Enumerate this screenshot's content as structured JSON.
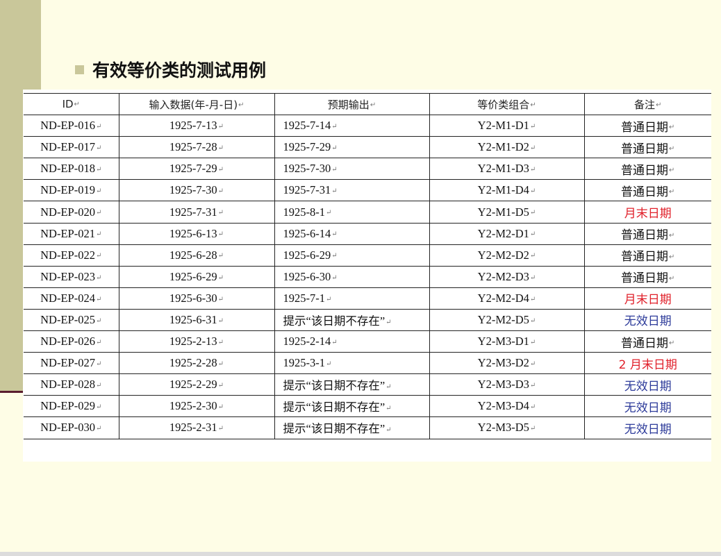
{
  "slide": {
    "heading": "有效等价类的测试用例",
    "colors": {
      "background": "#fefde6",
      "side_bar": "#c9c79a",
      "side_stripe": "#5a1d2e",
      "note_red": "#e0202a",
      "note_blue": "#2d3b9a"
    },
    "icons": [
      "square-bullet-icon",
      "paragraph-mark-icon"
    ]
  },
  "table": {
    "paragraph_mark": "↵",
    "headers": [
      "ID",
      "输入数据(年-月-日)",
      "预期输出",
      "等价类组合",
      "备注"
    ],
    "rows": [
      {
        "id": "ND-EP-016",
        "input": "1925-7-13",
        "expected": "1925-7-14",
        "combo": "Y2-M1-D1",
        "note": "普通日期",
        "note_color": "black",
        "note_mark": true
      },
      {
        "id": "ND-EP-017",
        "input": "1925-7-28",
        "expected": "1925-7-29",
        "combo": "Y2-M1-D2",
        "note": "普通日期",
        "note_color": "black",
        "note_mark": true
      },
      {
        "id": "ND-EP-018",
        "input": "1925-7-29",
        "expected": "1925-7-30",
        "combo": "Y2-M1-D3",
        "note": "普通日期",
        "note_color": "black",
        "note_mark": true
      },
      {
        "id": "ND-EP-019",
        "input": "1925-7-30",
        "expected": "1925-7-31",
        "combo": "Y2-M1-D4",
        "note": "普通日期",
        "note_color": "black",
        "note_mark": true
      },
      {
        "id": "ND-EP-020",
        "input": "1925-7-31",
        "expected": "1925-8-1",
        "combo": "Y2-M1-D5",
        "note": "月末日期",
        "note_color": "red",
        "note_mark": false
      },
      {
        "id": "ND-EP-021",
        "input": "1925-6-13",
        "expected": "1925-6-14",
        "combo": "Y2-M2-D1",
        "note": "普通日期",
        "note_color": "black",
        "note_mark": true
      },
      {
        "id": "ND-EP-022",
        "input": "1925-6-28",
        "expected": "1925-6-29",
        "combo": "Y2-M2-D2",
        "note": "普通日期",
        "note_color": "black",
        "note_mark": true
      },
      {
        "id": "ND-EP-023",
        "input": "1925-6-29",
        "expected": "1925-6-30",
        "combo": "Y2-M2-D3",
        "note": "普通日期",
        "note_color": "black",
        "note_mark": true
      },
      {
        "id": "ND-EP-024",
        "input": "1925-6-30",
        "expected": "1925-7-1",
        "combo": "Y2-M2-D4",
        "note": "月末日期",
        "note_color": "red",
        "note_mark": false
      },
      {
        "id": "ND-EP-025",
        "input": "1925-6-31",
        "expected": "提示“该日期不存在”",
        "combo": "Y2-M2-D5",
        "note": "无效日期",
        "note_color": "blue",
        "note_mark": false
      },
      {
        "id": "ND-EP-026",
        "input": "1925-2-13",
        "expected": "1925-2-14",
        "combo": "Y2-M3-D1",
        "note": "普通日期",
        "note_color": "black",
        "note_mark": true
      },
      {
        "id": "ND-EP-027",
        "input": "1925-2-28",
        "expected": "1925-3-1",
        "combo": "Y2-M3-D2",
        "note": "2 月末日期",
        "note_color": "red",
        "note_mark": false
      },
      {
        "id": "ND-EP-028",
        "input": "1925-2-29",
        "expected": "提示“该日期不存在”",
        "combo": "Y2-M3-D3",
        "note": "无效日期",
        "note_color": "blue",
        "note_mark": false
      },
      {
        "id": "ND-EP-029",
        "input": "1925-2-30",
        "expected": "提示“该日期不存在”",
        "combo": "Y2-M3-D4",
        "note": "无效日期",
        "note_color": "blue",
        "note_mark": false
      },
      {
        "id": "ND-EP-030",
        "input": "1925-2-31",
        "expected": "提示“该日期不存在”",
        "combo": "Y2-M3-D5",
        "note": "无效日期",
        "note_color": "blue",
        "note_mark": false
      }
    ]
  }
}
